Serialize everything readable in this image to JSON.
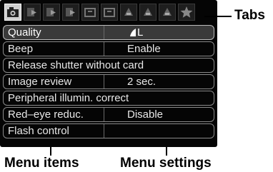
{
  "tabs": [
    {
      "icon": "camera-shooting-tab-icon",
      "active": true
    },
    {
      "icon": "playback-tab-1-icon",
      "active": false
    },
    {
      "icon": "playback-tab-2-icon",
      "active": false
    },
    {
      "icon": "playback-tab-3-icon",
      "active": false
    },
    {
      "icon": "setup-tab-1-icon",
      "active": false
    },
    {
      "icon": "setup-tab-2-icon",
      "active": false
    },
    {
      "icon": "custom-function-tab-1-icon",
      "active": false
    },
    {
      "icon": "custom-function-tab-2-icon",
      "active": false
    },
    {
      "icon": "custom-function-tab-3-icon",
      "active": false
    },
    {
      "icon": "my-menu-star-icon",
      "active": false
    }
  ],
  "menu": {
    "items": [
      {
        "label": "Quality",
        "value": "L",
        "value_icon": "quality-large-icon",
        "selected": true
      },
      {
        "label": "Beep",
        "value": "Enable"
      },
      {
        "label": "Release shutter without card",
        "value": ""
      },
      {
        "label": "Image review",
        "value": "2 sec."
      },
      {
        "label": "Peripheral illumin. correct",
        "value": ""
      },
      {
        "label": "Red–eye reduc.",
        "value": "Disable"
      },
      {
        "label": "Flash control",
        "value": ""
      }
    ]
  },
  "annotations": {
    "tabs": "Tabs",
    "menu_items": "Menu items",
    "menu_settings": "Menu settings"
  },
  "colors": {
    "screen_background": "#050505",
    "menu_text": "#e8e8e8",
    "annotation_text": "#000000"
  }
}
